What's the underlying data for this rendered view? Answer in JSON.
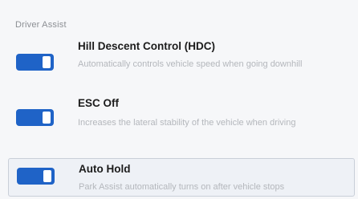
{
  "section": {
    "title": "Driver Assist"
  },
  "settings": [
    {
      "label": "Hill Descent Control (HDC)",
      "description": "Automatically controls vehicle speed when going downhill",
      "enabled": true
    },
    {
      "label": "ESC Off",
      "description": "Increases the lateral stability of the vehicle when driving",
      "enabled": true
    },
    {
      "label": "Auto Hold",
      "description": "Park Assist automatically turns on after vehicle stops",
      "enabled": true
    }
  ],
  "colors": {
    "toggle_on": "#1f63c7",
    "selected_row_border": "#c9cfd8"
  }
}
